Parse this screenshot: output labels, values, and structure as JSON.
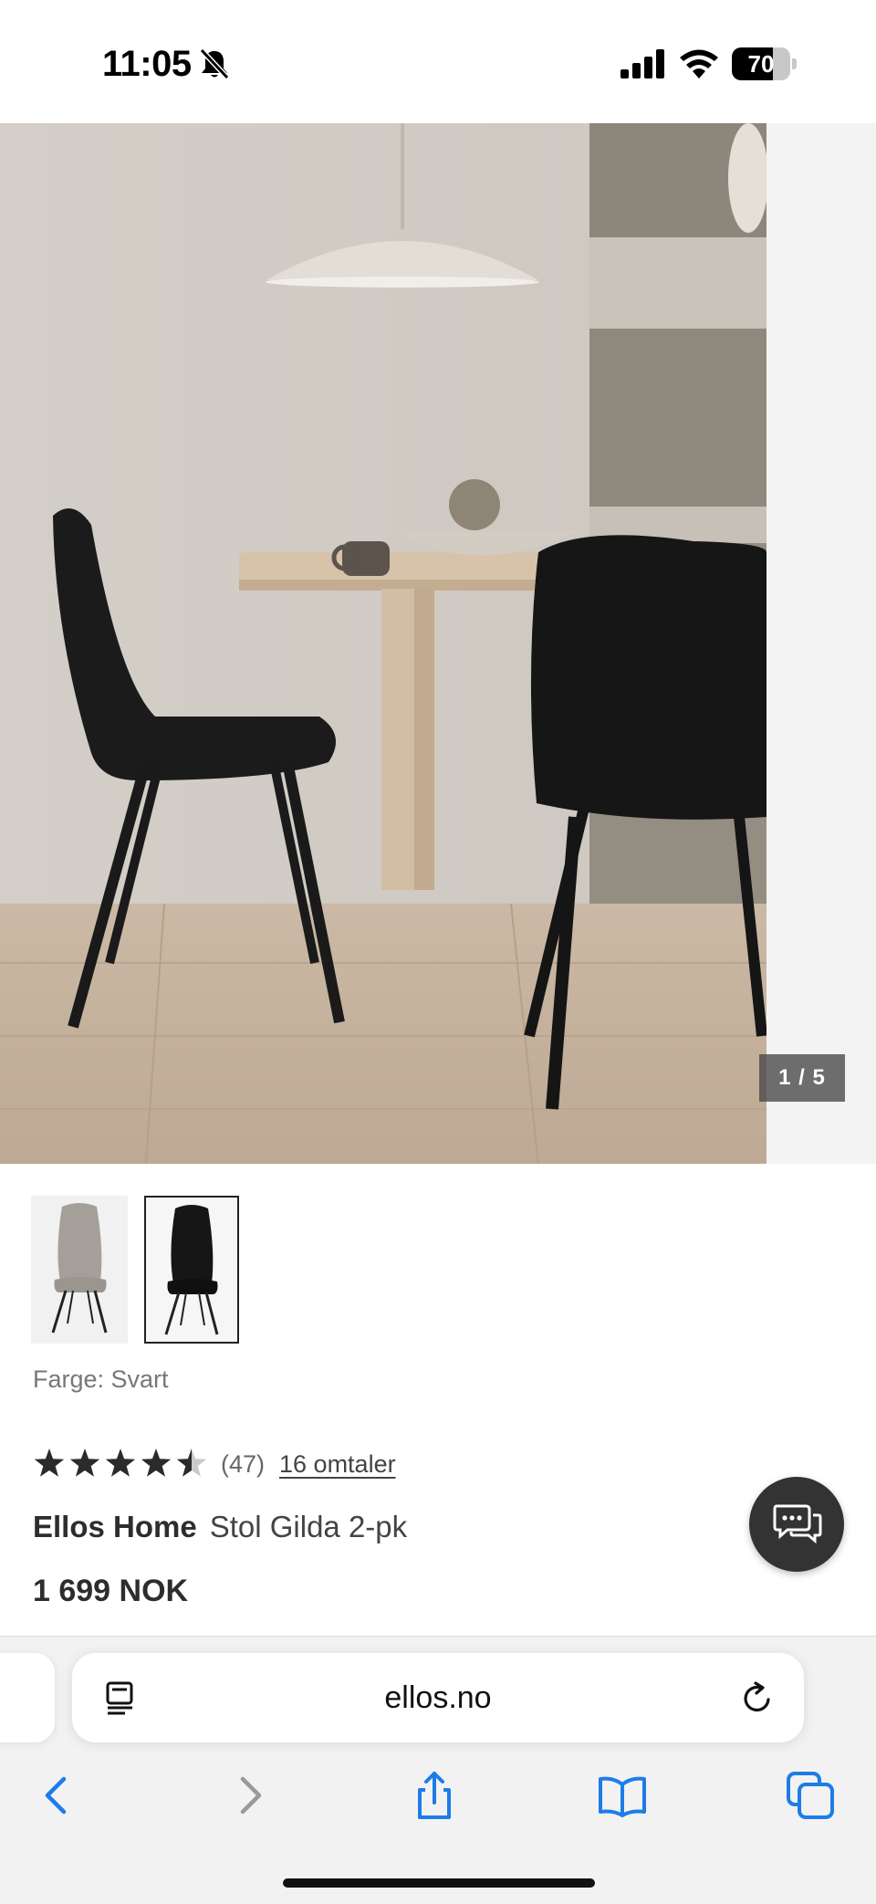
{
  "status_bar": {
    "time": "11:05",
    "battery": "70",
    "battery_level": 0.7,
    "icons": [
      "bell-slash-icon",
      "cellular-signal-icon",
      "wifi-icon",
      "battery-icon"
    ]
  },
  "gallery": {
    "counter": "1 / 5",
    "current": 1,
    "total": 5,
    "thumbnails": [
      {
        "name": "grey-chair-thumbnail",
        "selected": false
      },
      {
        "name": "black-chair-thumbnail",
        "selected": true
      }
    ]
  },
  "product": {
    "color_label": "Farge: Svart",
    "rating": 4.5,
    "rating_count": "(47)",
    "reviews_link": "16 omtaler",
    "brand": "Ellos Home",
    "name": "Stol Gilda 2-pk",
    "price": "1 699 NOK"
  },
  "chat": {
    "icon": "chat-bubbles-icon"
  },
  "browser": {
    "url": "ellos.no",
    "toolbar": [
      "back-icon",
      "forward-icon",
      "share-icon",
      "bookmarks-icon",
      "tabs-icon"
    ],
    "accent_color": "#1e7ce8"
  }
}
